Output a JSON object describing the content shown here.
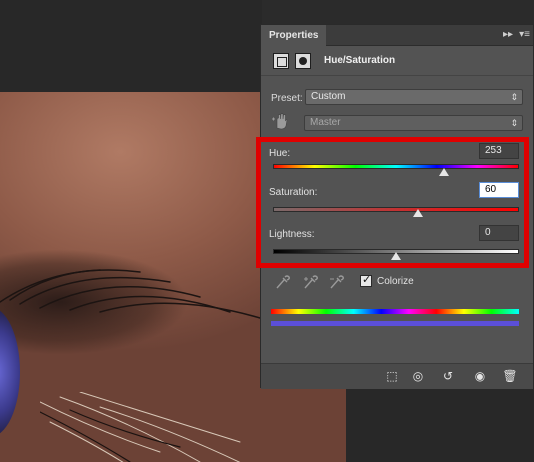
{
  "panel": {
    "tab_label": "Properties",
    "adjustment_title": "Hue/Saturation"
  },
  "preset": {
    "label": "Preset:",
    "value": "Custom",
    "channel_value": "Master"
  },
  "sliders": {
    "hue": {
      "label": "Hue:",
      "value": "253",
      "position": 0.7
    },
    "saturation": {
      "label": "Saturation:",
      "value": "60",
      "position": 0.6
    },
    "lightness": {
      "label": "Lightness:",
      "value": "0",
      "position": 0.5
    }
  },
  "colorize": {
    "label": "Colorize",
    "checked": true
  },
  "colors": {
    "highlight": "#e00000",
    "panel_bg": "#535353",
    "colorize_bar": "#5b4fd8"
  },
  "icons": {
    "collapse": "double-chevron-right-icon",
    "menu": "panel-menu-icon",
    "adjustment": "adjustment-layer-icon",
    "mask": "layer-mask-icon",
    "hand": "targeted-adjustment-hand-icon",
    "eyedropper": "eyedropper-icon",
    "eyedropper_plus": "eyedropper-plus-icon",
    "eyedropper_minus": "eyedropper-minus-icon",
    "clip": "clip-to-layer-icon",
    "view_previous": "view-previous-state-icon",
    "reset": "reset-icon",
    "visibility": "eye-icon",
    "delete": "trash-icon"
  }
}
